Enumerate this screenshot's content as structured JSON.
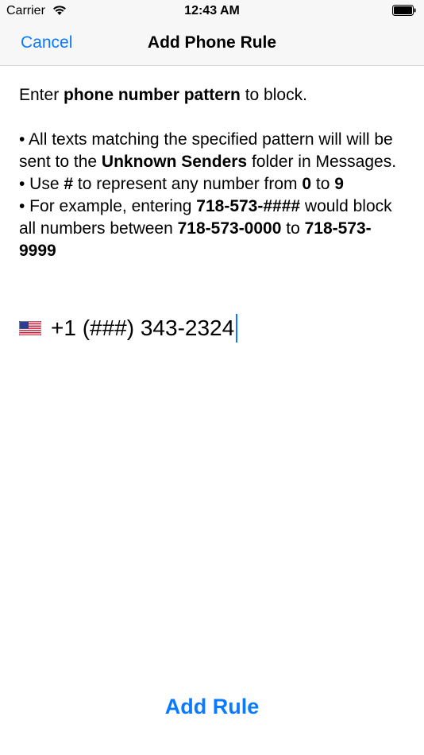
{
  "status_bar": {
    "carrier": "Carrier",
    "time": "12:43 AM",
    "icons": [
      "wifi-icon",
      "battery-icon"
    ]
  },
  "nav": {
    "cancel_label": "Cancel",
    "title": "Add Phone Rule"
  },
  "instructions": {
    "line1_pre": "Enter ",
    "line1_bold": "phone number pattern",
    "line1_post": " to block.",
    "b1_pre": "• All texts matching the specified pattern will will be sent to the ",
    "b1_bold": "Unknown Senders",
    "b1_post": " folder in Messages.",
    "b2_pre": "• Use ",
    "b2_bold1": "#",
    "b2_mid1": " to represent any number from ",
    "b2_bold2": "0",
    "b2_mid2": " to ",
    "b2_bold3": "9",
    "b3_pre": "• For example, entering ",
    "b3_bold1": "718-573-####",
    "b3_mid1": " would block all numbers between ",
    "b3_bold2": "718-573-0000",
    "b3_mid2": " to ",
    "b3_bold3": "718-573-9999"
  },
  "phone_input": {
    "flag_icon": "us-flag-icon",
    "value": "+1 (###) 343-2324"
  },
  "add_rule_label": "Add Rule",
  "colors": {
    "accent": "#0a7aff",
    "bar_background": "#f7f7f7"
  }
}
